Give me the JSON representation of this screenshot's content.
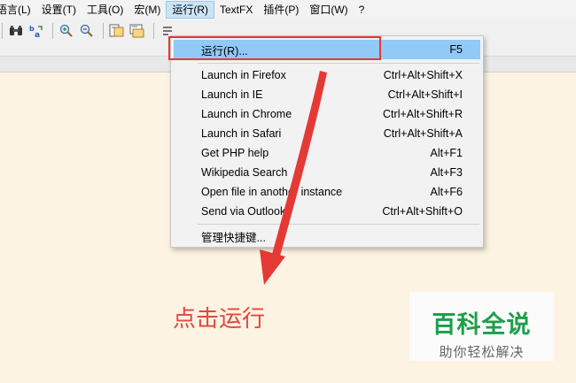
{
  "menubar": {
    "items": [
      {
        "label": "语言(L)"
      },
      {
        "label": "设置(T)"
      },
      {
        "label": "工具(O)"
      },
      {
        "label": "宏(M)"
      },
      {
        "label": "运行(R)"
      },
      {
        "label": "TextFX"
      },
      {
        "label": "插件(P)"
      },
      {
        "label": "窗口(W)"
      },
      {
        "label": "?"
      }
    ]
  },
  "run_menu": {
    "items": [
      {
        "label": "运行(R)...",
        "shortcut": "F5"
      },
      {
        "label": "Launch in Firefox",
        "shortcut": "Ctrl+Alt+Shift+X"
      },
      {
        "label": "Launch in IE",
        "shortcut": "Ctrl+Alt+Shift+I"
      },
      {
        "label": "Launch in Chrome",
        "shortcut": "Ctrl+Alt+Shift+R"
      },
      {
        "label": "Launch in Safari",
        "shortcut": "Ctrl+Alt+Shift+A"
      },
      {
        "label": "Get PHP help",
        "shortcut": "Alt+F1"
      },
      {
        "label": "Wikipedia Search",
        "shortcut": "Alt+F3"
      },
      {
        "label": "Open file in another instance",
        "shortcut": "Alt+F6"
      },
      {
        "label": "Send via Outlook",
        "shortcut": "Ctrl+Alt+Shift+O"
      },
      {
        "label": "管理快捷键...",
        "shortcut": ""
      }
    ]
  },
  "annotation": {
    "caption": "点击运行",
    "color": "#e0483e"
  },
  "watermark": {
    "main": "百科全说",
    "sub": "助你轻松解决",
    "color": "#1f9e4a"
  },
  "toolbar": {
    "icons": [
      "binoculars-icon",
      "replace-icon",
      "zoom-in-icon",
      "zoom-out-icon",
      "sync-vertical-icon",
      "sync-horizontal-icon",
      "word-wrap-icon"
    ]
  }
}
